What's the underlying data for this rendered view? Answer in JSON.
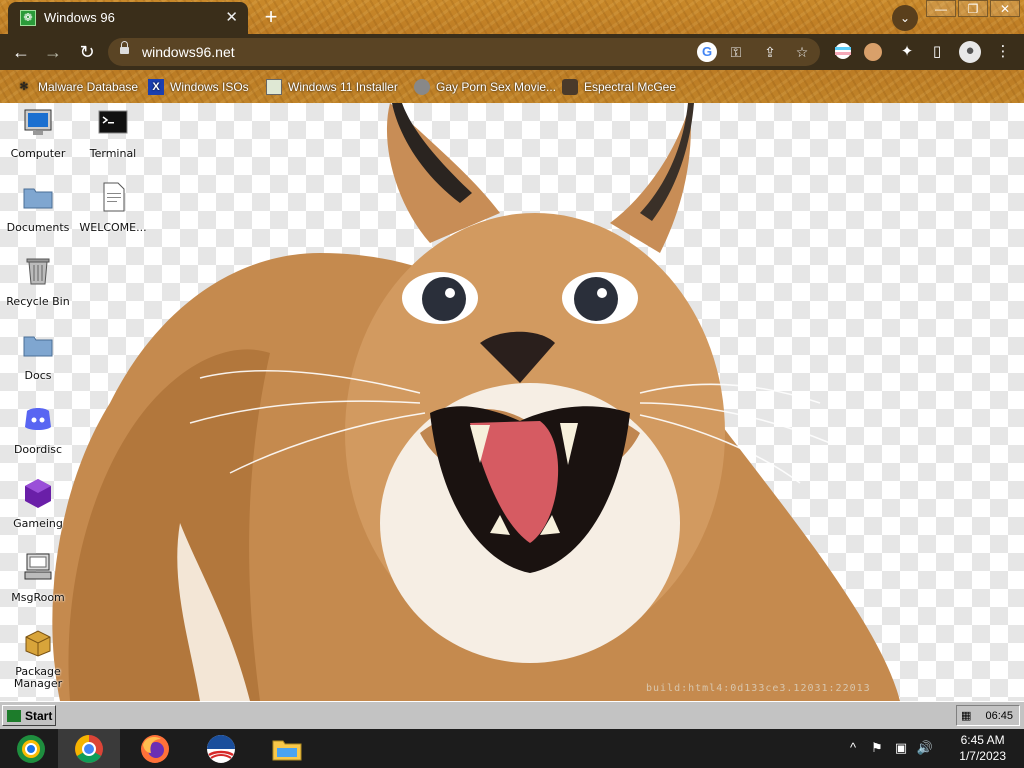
{
  "browser": {
    "tab": {
      "title": "Windows 96",
      "close": "✕"
    },
    "new_tab": "+",
    "tab_search": "⌄",
    "window_controls": {
      "minimize": "—",
      "restore": "❐",
      "close": "✕"
    },
    "nav": {
      "back": "←",
      "forward": "→",
      "reload": "↻"
    },
    "address": {
      "url": "windows96.net"
    },
    "omnibox_icons": {
      "google": "G",
      "key": "⚿",
      "share": "⇪",
      "star": "☆"
    },
    "toolbar_icons": {
      "extensions": "✦",
      "sidepanel": "▯",
      "profile": "●",
      "menu": "⋮"
    },
    "bookmarks": [
      {
        "label": "Malware Database",
        "icon": "spider-icon"
      },
      {
        "label": "Windows ISOs",
        "icon": "x-icon"
      },
      {
        "label": "Windows 11 Installer",
        "icon": "image-icon"
      },
      {
        "label": "Gay Porn Sex Movie...",
        "icon": "disc-icon"
      },
      {
        "label": "Espectral McGee",
        "icon": "face-icon"
      }
    ]
  },
  "desktop": {
    "build_text": "build:html4:0d133ce3.12031:22013",
    "icons": [
      {
        "label": "Computer",
        "icon": "computer-icon"
      },
      {
        "label": "Terminal",
        "icon": "terminal-icon"
      },
      {
        "label": "Documents",
        "icon": "folder-icon"
      },
      {
        "label": "WELCOME...",
        "icon": "document-icon"
      },
      {
        "label": "Recycle Bin",
        "icon": "recycle-bin-icon"
      },
      {
        "label": "Docs",
        "icon": "folder-icon"
      },
      {
        "label": "Doordisc",
        "icon": "discord-icon"
      },
      {
        "label": "Gameing",
        "icon": "cube-icon"
      },
      {
        "label": "MsgRoom",
        "icon": "msgroom-icon"
      },
      {
        "label": "Package Manager",
        "icon": "package-icon"
      }
    ]
  },
  "win96_taskbar": {
    "start_label": "Start",
    "time": "06:45"
  },
  "win10_taskbar": {
    "apps": [
      "chromeos-icon",
      "chrome-icon",
      "firefox-icon",
      "obama-icon",
      "file-explorer-icon"
    ],
    "tray": {
      "chevron": "^",
      "flag": "⚑",
      "network": "▣",
      "volume": "🔊"
    },
    "time": "6:45 AM",
    "date": "1/7/2023"
  },
  "colors": {
    "chrome_accent": "#c9892a",
    "chrome_dark": "#3a2e1a",
    "win96_gray": "#c3c3c3",
    "win10_bar": "#1c1c1c"
  }
}
